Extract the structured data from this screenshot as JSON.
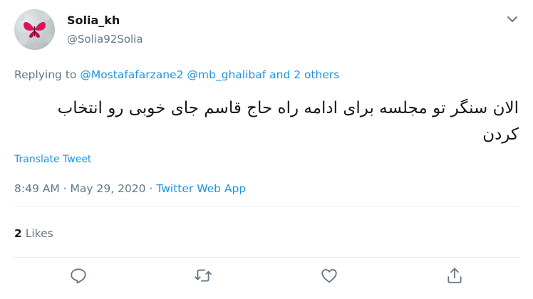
{
  "author": {
    "display_name": "Solia_kh",
    "handle": "@Solia92Solia"
  },
  "reply": {
    "prefix": "Replying to",
    "mention1": "@Mostafafarzane2",
    "mention2": "@mb_ghalibaf",
    "rest": "and 2 others"
  },
  "tweet": {
    "text": "الان سنگر تو مجلسه برای ادامه راه حاج قاسم جای خوبی رو انتخاب کردن",
    "translate_label": "Translate Tweet"
  },
  "meta": {
    "time": "8:49 AM",
    "sep": "·",
    "date": "May 29, 2020",
    "source": "Twitter Web App"
  },
  "engagement": {
    "likes_count": "2",
    "likes_label": "Likes"
  },
  "icons": {
    "reply": "reply-icon",
    "retweet": "retweet-icon",
    "like": "heart-icon",
    "share": "share-icon",
    "more": "chevron-down-icon"
  },
  "colors": {
    "link": "#1b95e0",
    "muted": "#657786",
    "avatar_accent": "#e0105a"
  }
}
